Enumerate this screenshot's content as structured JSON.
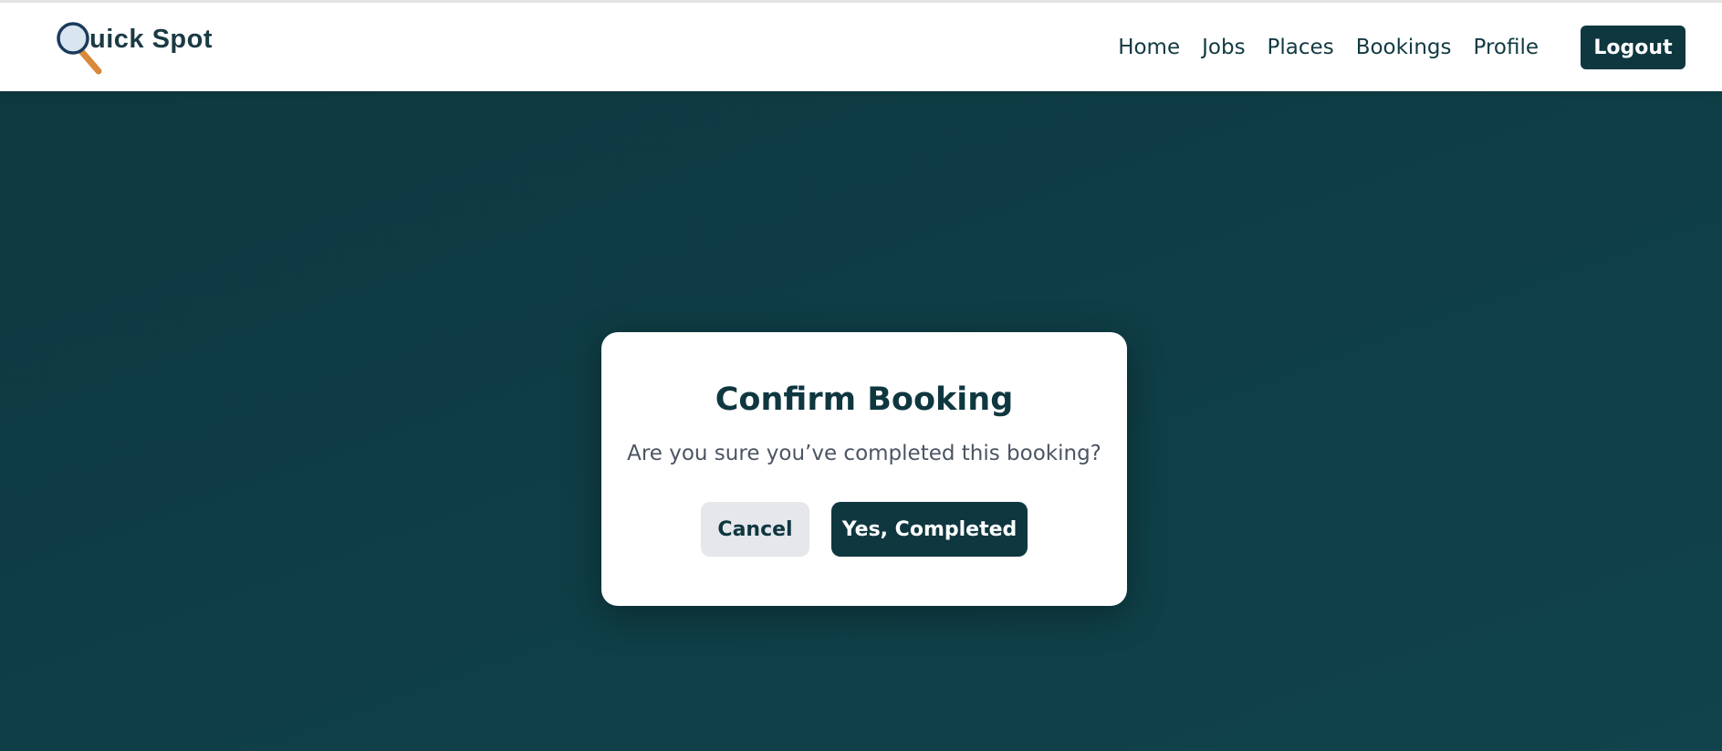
{
  "brand": {
    "name": "uick Spot",
    "icon": "magnifying-glass-icon"
  },
  "nav": {
    "links": [
      "Home",
      "Jobs",
      "Places",
      "Bookings",
      "Profile"
    ],
    "logout_label": "Logout"
  },
  "modal": {
    "title": "Confirm Booking",
    "message": "Are you sure you’ve completed this booking?",
    "cancel_label": "Cancel",
    "confirm_label": "Yes, Completed"
  },
  "colors": {
    "primary": "#0f3740",
    "background": "#0e3840",
    "cancel_bg": "#e5e7eb",
    "text_muted": "#4b5563",
    "magnifier_handle": "#d8893a"
  }
}
